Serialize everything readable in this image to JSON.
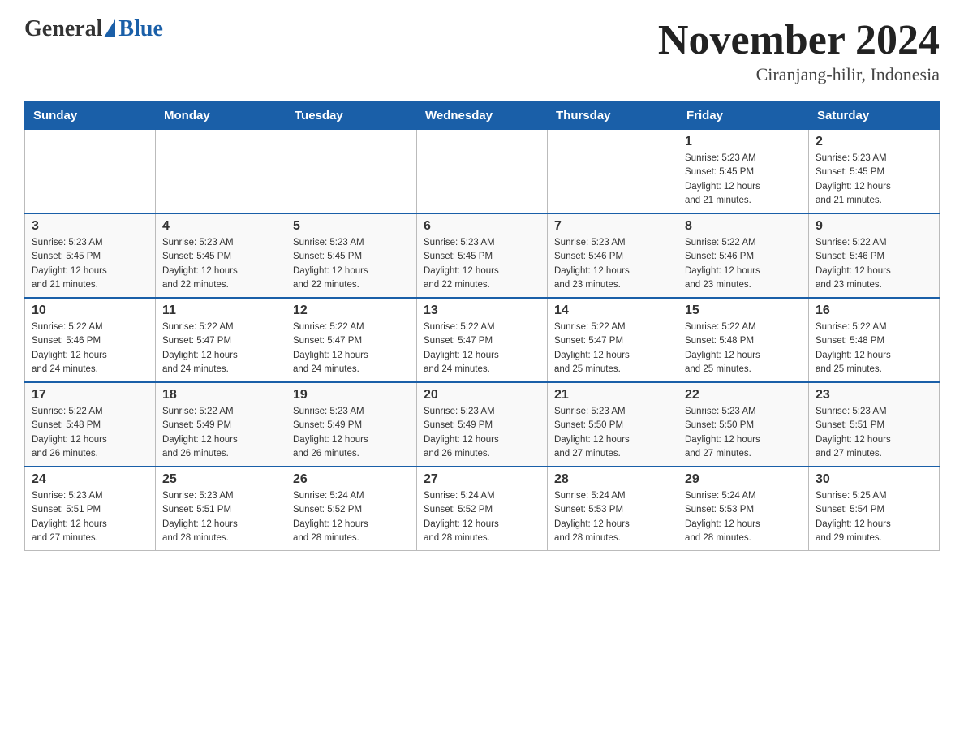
{
  "header": {
    "logo_general": "General",
    "logo_blue": "Blue",
    "month_title": "November 2024",
    "location": "Ciranjang-hilir, Indonesia"
  },
  "days_of_week": [
    "Sunday",
    "Monday",
    "Tuesday",
    "Wednesday",
    "Thursday",
    "Friday",
    "Saturday"
  ],
  "weeks": [
    {
      "days": [
        {
          "number": "",
          "info": ""
        },
        {
          "number": "",
          "info": ""
        },
        {
          "number": "",
          "info": ""
        },
        {
          "number": "",
          "info": ""
        },
        {
          "number": "",
          "info": ""
        },
        {
          "number": "1",
          "info": "Sunrise: 5:23 AM\nSunset: 5:45 PM\nDaylight: 12 hours\nand 21 minutes."
        },
        {
          "number": "2",
          "info": "Sunrise: 5:23 AM\nSunset: 5:45 PM\nDaylight: 12 hours\nand 21 minutes."
        }
      ]
    },
    {
      "days": [
        {
          "number": "3",
          "info": "Sunrise: 5:23 AM\nSunset: 5:45 PM\nDaylight: 12 hours\nand 21 minutes."
        },
        {
          "number": "4",
          "info": "Sunrise: 5:23 AM\nSunset: 5:45 PM\nDaylight: 12 hours\nand 22 minutes."
        },
        {
          "number": "5",
          "info": "Sunrise: 5:23 AM\nSunset: 5:45 PM\nDaylight: 12 hours\nand 22 minutes."
        },
        {
          "number": "6",
          "info": "Sunrise: 5:23 AM\nSunset: 5:45 PM\nDaylight: 12 hours\nand 22 minutes."
        },
        {
          "number": "7",
          "info": "Sunrise: 5:23 AM\nSunset: 5:46 PM\nDaylight: 12 hours\nand 23 minutes."
        },
        {
          "number": "8",
          "info": "Sunrise: 5:22 AM\nSunset: 5:46 PM\nDaylight: 12 hours\nand 23 minutes."
        },
        {
          "number": "9",
          "info": "Sunrise: 5:22 AM\nSunset: 5:46 PM\nDaylight: 12 hours\nand 23 minutes."
        }
      ]
    },
    {
      "days": [
        {
          "number": "10",
          "info": "Sunrise: 5:22 AM\nSunset: 5:46 PM\nDaylight: 12 hours\nand 24 minutes."
        },
        {
          "number": "11",
          "info": "Sunrise: 5:22 AM\nSunset: 5:47 PM\nDaylight: 12 hours\nand 24 minutes."
        },
        {
          "number": "12",
          "info": "Sunrise: 5:22 AM\nSunset: 5:47 PM\nDaylight: 12 hours\nand 24 minutes."
        },
        {
          "number": "13",
          "info": "Sunrise: 5:22 AM\nSunset: 5:47 PM\nDaylight: 12 hours\nand 24 minutes."
        },
        {
          "number": "14",
          "info": "Sunrise: 5:22 AM\nSunset: 5:47 PM\nDaylight: 12 hours\nand 25 minutes."
        },
        {
          "number": "15",
          "info": "Sunrise: 5:22 AM\nSunset: 5:48 PM\nDaylight: 12 hours\nand 25 minutes."
        },
        {
          "number": "16",
          "info": "Sunrise: 5:22 AM\nSunset: 5:48 PM\nDaylight: 12 hours\nand 25 minutes."
        }
      ]
    },
    {
      "days": [
        {
          "number": "17",
          "info": "Sunrise: 5:22 AM\nSunset: 5:48 PM\nDaylight: 12 hours\nand 26 minutes."
        },
        {
          "number": "18",
          "info": "Sunrise: 5:22 AM\nSunset: 5:49 PM\nDaylight: 12 hours\nand 26 minutes."
        },
        {
          "number": "19",
          "info": "Sunrise: 5:23 AM\nSunset: 5:49 PM\nDaylight: 12 hours\nand 26 minutes."
        },
        {
          "number": "20",
          "info": "Sunrise: 5:23 AM\nSunset: 5:49 PM\nDaylight: 12 hours\nand 26 minutes."
        },
        {
          "number": "21",
          "info": "Sunrise: 5:23 AM\nSunset: 5:50 PM\nDaylight: 12 hours\nand 27 minutes."
        },
        {
          "number": "22",
          "info": "Sunrise: 5:23 AM\nSunset: 5:50 PM\nDaylight: 12 hours\nand 27 minutes."
        },
        {
          "number": "23",
          "info": "Sunrise: 5:23 AM\nSunset: 5:51 PM\nDaylight: 12 hours\nand 27 minutes."
        }
      ]
    },
    {
      "days": [
        {
          "number": "24",
          "info": "Sunrise: 5:23 AM\nSunset: 5:51 PM\nDaylight: 12 hours\nand 27 minutes."
        },
        {
          "number": "25",
          "info": "Sunrise: 5:23 AM\nSunset: 5:51 PM\nDaylight: 12 hours\nand 28 minutes."
        },
        {
          "number": "26",
          "info": "Sunrise: 5:24 AM\nSunset: 5:52 PM\nDaylight: 12 hours\nand 28 minutes."
        },
        {
          "number": "27",
          "info": "Sunrise: 5:24 AM\nSunset: 5:52 PM\nDaylight: 12 hours\nand 28 minutes."
        },
        {
          "number": "28",
          "info": "Sunrise: 5:24 AM\nSunset: 5:53 PM\nDaylight: 12 hours\nand 28 minutes."
        },
        {
          "number": "29",
          "info": "Sunrise: 5:24 AM\nSunset: 5:53 PM\nDaylight: 12 hours\nand 28 minutes."
        },
        {
          "number": "30",
          "info": "Sunrise: 5:25 AM\nSunset: 5:54 PM\nDaylight: 12 hours\nand 29 minutes."
        }
      ]
    }
  ]
}
